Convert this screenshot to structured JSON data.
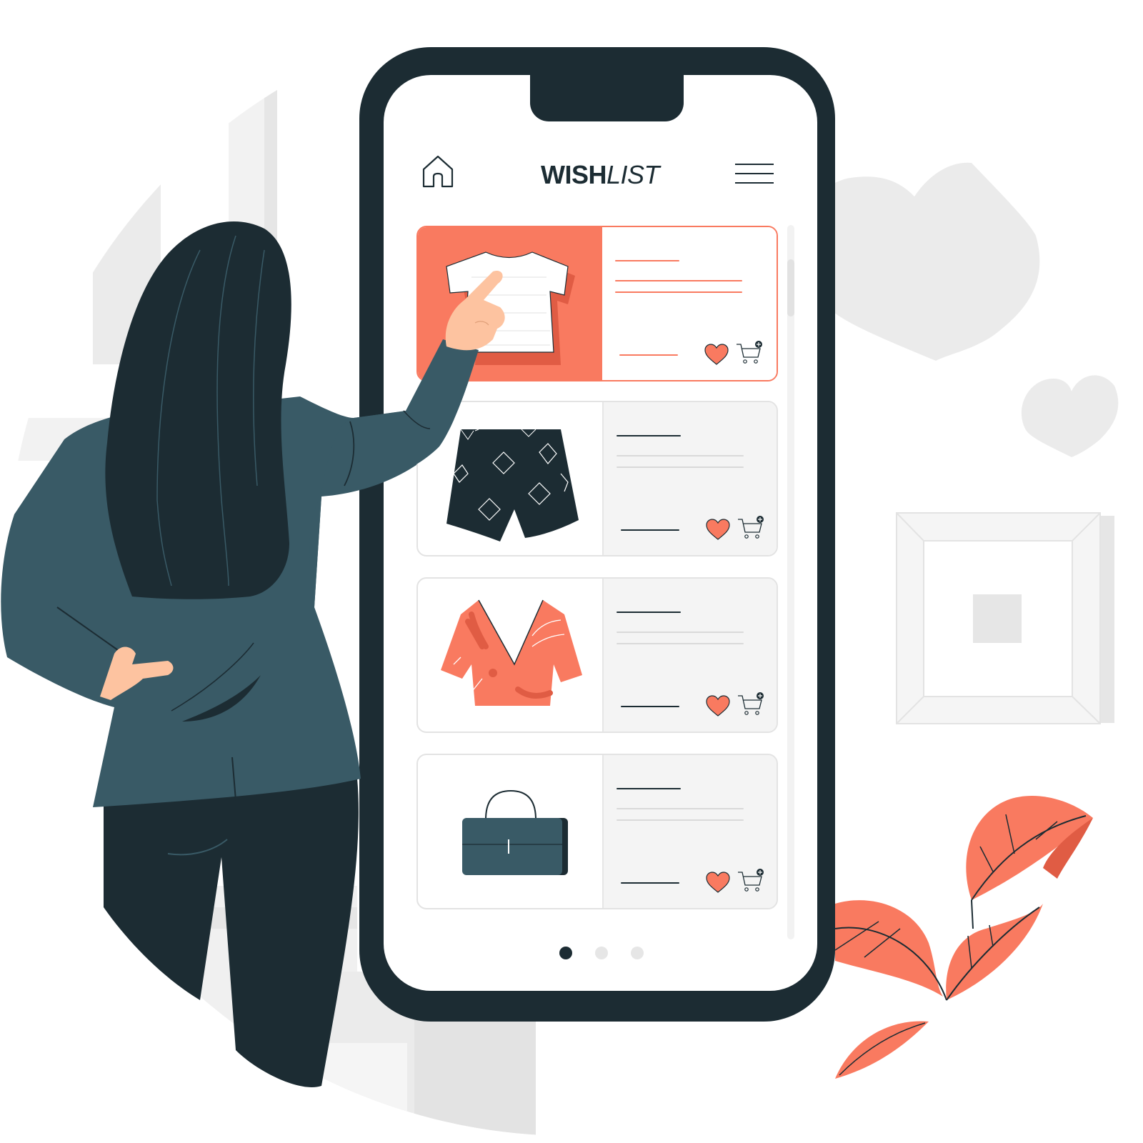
{
  "header": {
    "title_bold": "WISH",
    "title_light": "LIST",
    "home_icon": "home-icon",
    "menu_icon": "hamburger-menu-icon"
  },
  "wishlist": {
    "items": [
      {
        "product": "t-shirt",
        "icon": "tshirt-icon",
        "selected": true
      },
      {
        "product": "shorts",
        "icon": "shorts-icon",
        "selected": false
      },
      {
        "product": "blouse",
        "icon": "blouse-icon",
        "selected": false
      },
      {
        "product": "handbag",
        "icon": "handbag-icon",
        "selected": false
      }
    ],
    "item_actions": [
      "heart-icon",
      "add-to-cart-icon"
    ]
  },
  "pagination": {
    "pages": 3,
    "current": 1
  },
  "colors": {
    "accent": "#f97a60",
    "dark": "#1c2c33",
    "jacket": "#395a66",
    "skin": "#fdc3a0",
    "light_gray": "#e6e6e6"
  }
}
